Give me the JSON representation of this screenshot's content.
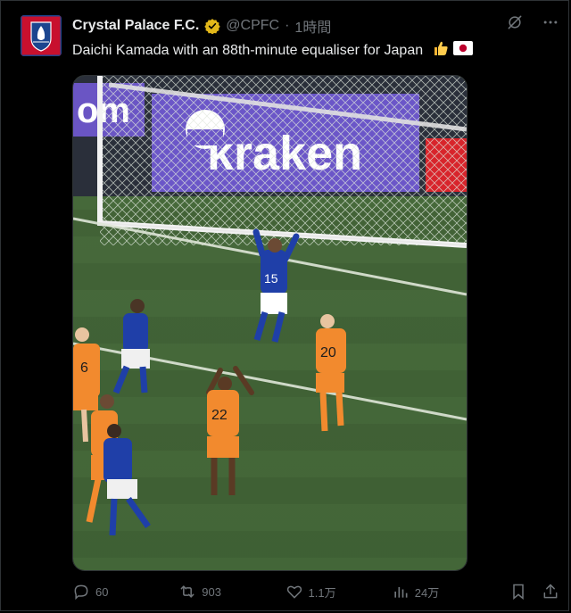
{
  "account": {
    "name": "Crystal Palace F.C.",
    "handle": "@CPFC",
    "separator": "·",
    "time": "1時間"
  },
  "tweet": {
    "text": "Daichi Kamada with an 88th-minute equaliser for Japan",
    "emojis": [
      "thumbs-up",
      "japan-flag"
    ]
  },
  "media": {
    "banner_text": "kraken",
    "players": [
      {
        "number": "15",
        "team": "Japan"
      },
      {
        "number": "6",
        "team": "Netherlands"
      },
      {
        "number": "20",
        "team": "Netherlands"
      },
      {
        "number": "22",
        "team": "Netherlands"
      }
    ]
  },
  "actions": {
    "replies": "60",
    "retweets": "903",
    "likes": "1.1万",
    "views": "24万"
  },
  "colors": {
    "background": "#000000",
    "muted": "#71767b",
    "text": "#e7e9ea",
    "verified": "#e2b719"
  }
}
